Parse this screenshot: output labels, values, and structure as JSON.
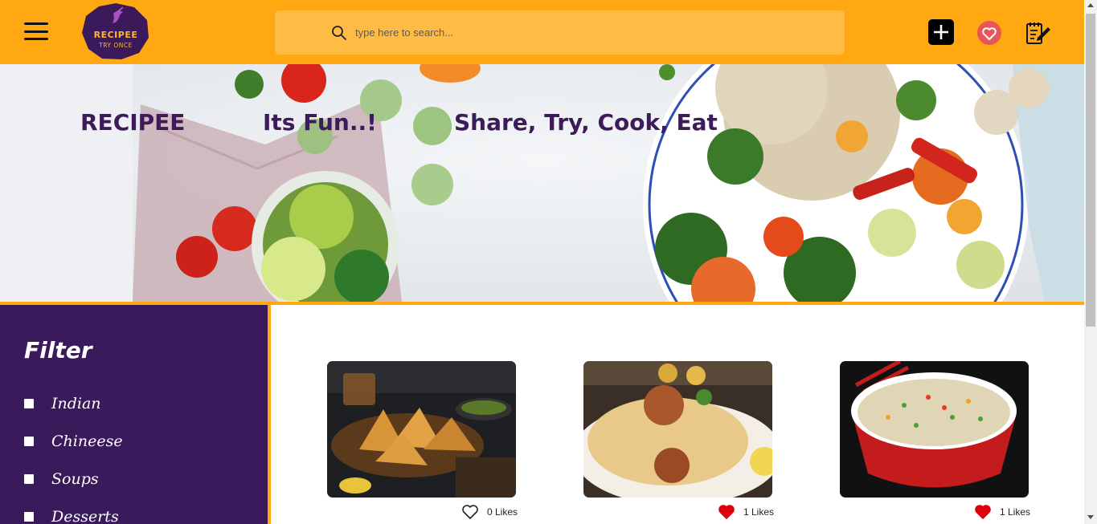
{
  "header": {
    "logo_text": "RECIPEE",
    "logo_tagline": "TRY ONCE",
    "search_placeholder": "type here to search...",
    "icons": [
      "menu-icon",
      "search-icon",
      "plus-icon",
      "heart-icon",
      "recipe-note-icon"
    ],
    "accent_color": "#ffa812"
  },
  "banner": {
    "text1": "RECIPEE",
    "text2": "Its Fun..!",
    "text3": "Share, Try, Cook, Eat",
    "text_color": "#3d1a5a"
  },
  "filter": {
    "title": "Filter",
    "items": [
      "Indian",
      "Chineese",
      "Soups",
      "Desserts"
    ],
    "bg_color": "#3a1a5a"
  },
  "recipes": [
    {
      "image": "samosa-photo",
      "likes": "0 Likes",
      "liked": false
    },
    {
      "image": "biryani-photo",
      "likes": "1 Likes",
      "liked": true
    },
    {
      "image": "fried-rice-photo",
      "likes": "1 Likes",
      "liked": true
    }
  ]
}
